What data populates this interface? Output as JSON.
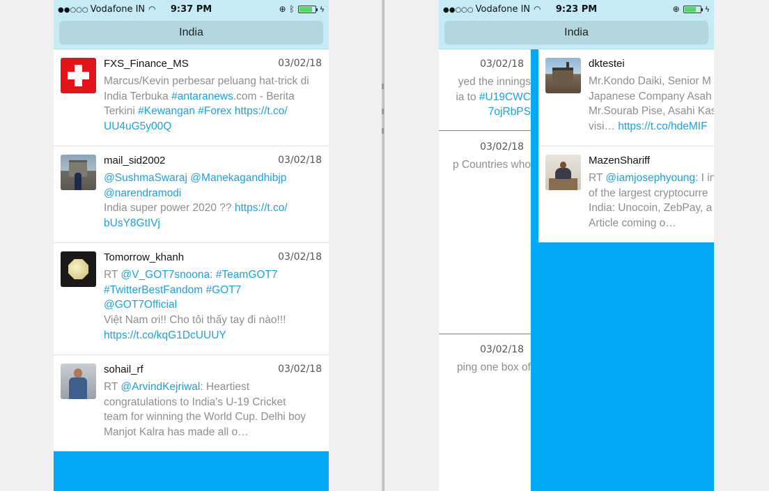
{
  "left_phone": {
    "status": {
      "carrier": "Vodafone IN",
      "time": "9:37 PM"
    },
    "nav_title": "India",
    "tweets": [
      {
        "user": "FXS_Finance_MS",
        "date": "03/02/18",
        "lines": [
          {
            "parts": [
              {
                "t": "Marcus/Kevin perbesar peluang hat-trick di"
              }
            ]
          },
          {
            "parts": [
              {
                "t": "India Terbuka "
              },
              {
                "t": "#antaranews",
                "link": true
              },
              {
                "t": ".com - Berita"
              }
            ]
          },
          {
            "parts": [
              {
                "t": "Terkini "
              },
              {
                "t": "#Kewangan",
                "link": true
              },
              {
                "t": " "
              },
              {
                "t": "#Forex",
                "link": true
              },
              {
                "t": " "
              },
              {
                "t": "https://t.co/",
                "link": true
              }
            ]
          },
          {
            "parts": [
              {
                "t": "UU4uG5y00Q",
                "link": true
              }
            ]
          }
        ]
      },
      {
        "user": "mail_sid2002",
        "date": "03/02/18",
        "lines": [
          {
            "parts": [
              {
                "t": "@SushmaSwaraj",
                "link": true
              },
              {
                "t": " "
              },
              {
                "t": "@Manekagandhibjp",
                "link": true
              }
            ]
          },
          {
            "parts": [
              {
                "t": "@narendramodi",
                "link": true
              }
            ]
          },
          {
            "parts": [
              {
                "t": "India super power 2020 ?? "
              },
              {
                "t": "https://t.co/",
                "link": true
              }
            ]
          },
          {
            "parts": [
              {
                "t": "bUsY8GtIVj",
                "link": true
              }
            ]
          }
        ]
      },
      {
        "user": "Tomorrow_khanh",
        "date": "03/02/18",
        "lines": [
          {
            "parts": [
              {
                "t": "RT "
              },
              {
                "t": "@V_GOT7snoona",
                "link": true
              },
              {
                "t": ": "
              },
              {
                "t": "#TeamGOT7",
                "link": true
              }
            ]
          },
          {
            "parts": [
              {
                "t": "#TwitterBestFandom",
                "link": true
              },
              {
                "t": " "
              },
              {
                "t": "#GOT7",
                "link": true
              }
            ]
          },
          {
            "parts": [
              {
                "t": "@GOT7Official",
                "link": true
              }
            ]
          },
          {
            "parts": [
              {
                "t": "Việt Nam ơi!! Cho tôi thấy tay đi nào!!!"
              }
            ]
          },
          {
            "parts": [
              {
                "t": "https://t.co/kqG1DcUUUY",
                "link": true
              }
            ]
          }
        ]
      },
      {
        "user": "sohail_rf",
        "date": "03/02/18",
        "lines": [
          {
            "parts": [
              {
                "t": "RT "
              },
              {
                "t": "@ArvindKejriwal",
                "link": true
              },
              {
                "t": ": Heartiest"
              }
            ]
          },
          {
            "parts": [
              {
                "t": "congratulations to India's U-19 Cricket"
              }
            ]
          },
          {
            "parts": [
              {
                "t": "team for winning the World Cup. Delhi boy"
              }
            ]
          },
          {
            "parts": [
              {
                "t": "Manjot Kalra has made all o…"
              }
            ]
          }
        ]
      }
    ]
  },
  "right_phone": {
    "status": {
      "carrier": "Vodafone IN",
      "time": "9:23 PM"
    },
    "nav_title": "India",
    "fragments": [
      {
        "date": "03/02/18",
        "lines": [
          {
            "parts": [
              {
                "t": "yed the innings"
              }
            ]
          },
          {
            "parts": [
              {
                "t": "ia to "
              },
              {
                "t": "#U19CWC",
                "link": true
              }
            ]
          },
          {
            "parts": [
              {
                "t": "7ojRbPS",
                "link": true
              }
            ]
          }
        ]
      },
      {
        "date": "03/02/18",
        "lines": [
          {
            "parts": [
              {
                "t": "p Countries who"
              }
            ]
          }
        ]
      },
      {
        "date": "03/02/18",
        "lines": [
          {
            "parts": [
              {
                "t": "ping one box of"
              }
            ]
          }
        ]
      }
    ],
    "tweets": [
      {
        "user": "dktestei",
        "lines": [
          {
            "parts": [
              {
                "t": "Mr.Kondo Daiki, Senior M"
              }
            ]
          },
          {
            "parts": [
              {
                "t": "Japanese Company Asah"
              }
            ]
          },
          {
            "parts": [
              {
                "t": "Mr.Sourab Pise, Asahi Kas"
              }
            ]
          },
          {
            "parts": [
              {
                "t": "visi… "
              },
              {
                "t": "https://t.co/hdeMIF",
                "link": true
              }
            ]
          }
        ]
      },
      {
        "user": "MazenShariff",
        "lines": [
          {
            "parts": [
              {
                "t": "RT "
              },
              {
                "t": "@iamjosephyoung",
                "link": true
              },
              {
                "t": ": I in"
              }
            ]
          },
          {
            "parts": [
              {
                "t": "of the largest cryptocurre"
              }
            ]
          },
          {
            "parts": [
              {
                "t": "India: Unocoin, ZebPay, a"
              }
            ]
          },
          {
            "parts": [
              {
                "t": "Article coming o…"
              }
            ]
          }
        ]
      }
    ]
  },
  "colors": {
    "nav_bg": "#c6ebf7",
    "nav_title_bg": "#b4d6df",
    "accent_blue": "#03a9f4",
    "link": "#1ba1e2",
    "body_text": "#8e8e93"
  },
  "icons": {
    "wifi": "wifi-icon",
    "lock": "orientation-lock-icon",
    "bluetooth": "bluetooth-icon",
    "battery": "battery-icon",
    "charging": "charging-bolt-icon"
  }
}
